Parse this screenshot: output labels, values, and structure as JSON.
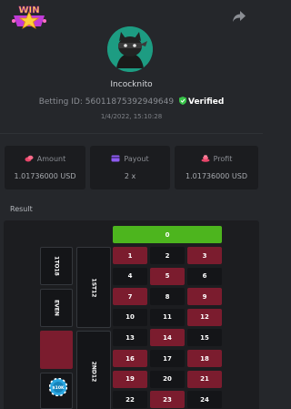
{
  "header": {
    "logo_text": "WIN",
    "logo_icon": "win-star-logo",
    "share_icon": "share-icon"
  },
  "profile": {
    "avatar_icon": "ninja-cat-avatar",
    "username": "Incocknito",
    "betting_id_label": "Betting ID:",
    "betting_id": "56011875392949649",
    "verified_label": "Verified",
    "verified_icon": "shield-check-icon",
    "datetime": "1/4/2022, 15:10:28"
  },
  "stats": {
    "amount": {
      "label": "Amount",
      "value": "1.01736000 USD",
      "icon": "coins-icon",
      "icon_color": "#e8466a"
    },
    "payout": {
      "label": "Payout",
      "value": "2 x",
      "icon": "card-icon",
      "icon_color": "#8e5bf0"
    },
    "profit": {
      "label": "Profit",
      "value": "1.01736000 USD",
      "icon": "profit-coins-icon",
      "icon_color": "#e8466a"
    }
  },
  "result": {
    "label": "Result",
    "zero": "0",
    "numbers": [
      [
        "1",
        "2",
        "3"
      ],
      [
        "4",
        "5",
        "6"
      ],
      [
        "7",
        "8",
        "9"
      ],
      [
        "10",
        "11",
        "12"
      ],
      [
        "13",
        "14",
        "15"
      ],
      [
        "16",
        "17",
        "18"
      ],
      [
        "19",
        "20",
        "21"
      ],
      [
        "22",
        "23",
        "24"
      ]
    ],
    "red_numbers": [
      "1",
      "3",
      "5",
      "7",
      "9",
      "12",
      "14",
      "16",
      "18",
      "19",
      "21",
      "23"
    ],
    "side_bets": {
      "low": "1TO18",
      "even": "EVEN",
      "dozen1": "1ST12",
      "dozen2": "2ND12"
    },
    "chip_value": "$10K",
    "colors": {
      "red": "#7b1c2e",
      "black": "#141518",
      "green": "#4db51e",
      "chip": "#2aa6e0"
    }
  }
}
